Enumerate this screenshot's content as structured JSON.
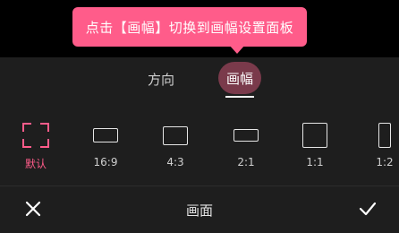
{
  "tooltip": {
    "text": "点击【画幅】切换到画幅设置面板"
  },
  "tabs": {
    "direction": "方向",
    "ratio": "画幅",
    "active": "ratio"
  },
  "ratios": [
    {
      "label": "默认",
      "active": true,
      "icon": "crop-corners-icon"
    },
    {
      "label": "16:9",
      "icon": "rect-16-9-icon"
    },
    {
      "label": "4:3",
      "icon": "rect-4-3-icon"
    },
    {
      "label": "2:1",
      "icon": "rect-2-1-icon"
    },
    {
      "label": "1:1",
      "icon": "square-1-1-icon"
    },
    {
      "label": "1:2",
      "icon": "rect-1-2-icon"
    }
  ],
  "bottom": {
    "title": "画面",
    "cancel_icon": "close-icon",
    "confirm_icon": "check-icon"
  },
  "colors": {
    "accent": "#ff5c8a",
    "tab_active_bg": "#7a3a4b",
    "background": "#1e1e1e"
  }
}
